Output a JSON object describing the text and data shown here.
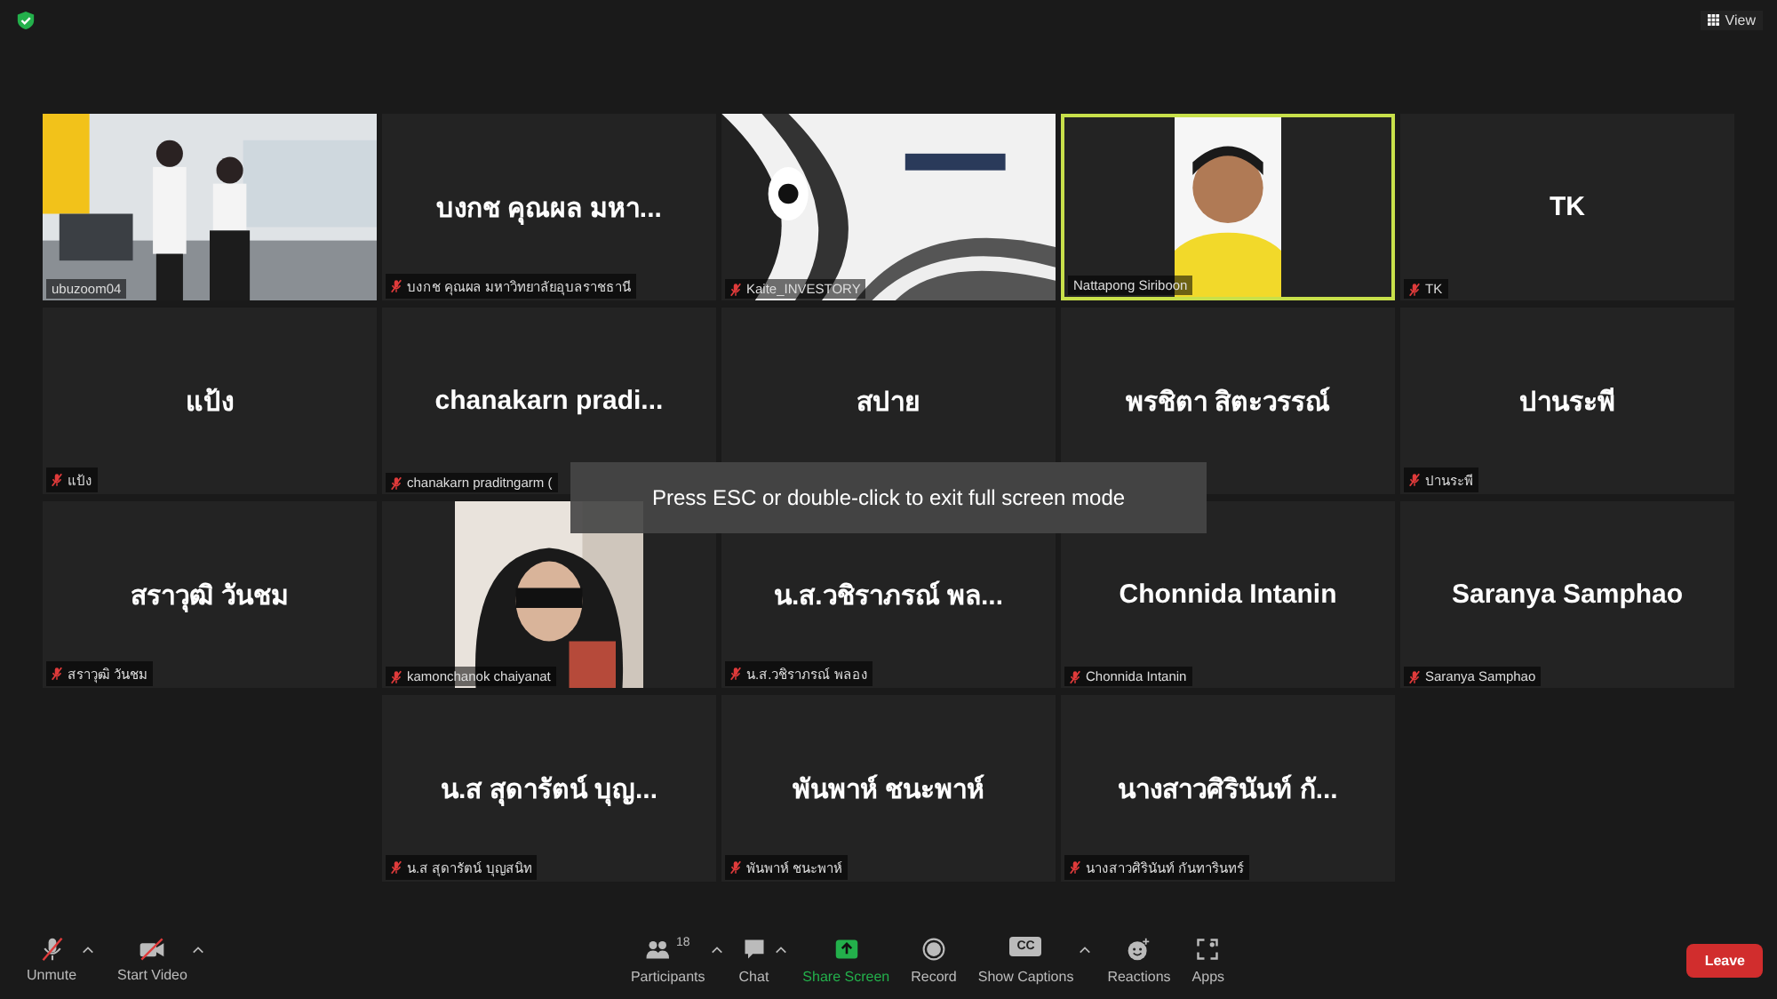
{
  "top_bar": {
    "view_button": "View"
  },
  "rows": [
    {
      "tiles": [
        {
          "kind": "video",
          "label": "ubuzoom04",
          "muted": false,
          "speaking": false,
          "portrait": false
        },
        {
          "kind": "name",
          "name": "บงกช คุณผล มหา...",
          "label": "บงกช คุณผล มหาวิทยาลัยอุบลราชธานี",
          "muted": true,
          "speaking": false
        },
        {
          "kind": "video",
          "label": "Kaite_INVESTORY",
          "muted": true,
          "speaking": false,
          "portrait": false
        },
        {
          "kind": "video",
          "label": "Nattapong Siriboon",
          "muted": false,
          "speaking": true,
          "portrait": true
        },
        {
          "kind": "name",
          "name": "TK",
          "label": "TK",
          "muted": true,
          "speaking": false
        }
      ]
    },
    {
      "tiles": [
        {
          "kind": "name",
          "name": "แป้ง",
          "label": "แป้ง",
          "muted": true,
          "speaking": false
        },
        {
          "kind": "name",
          "name": "chanakarn  pradi...",
          "label": "chanakarn praditngarm (",
          "muted": true,
          "speaking": false
        },
        {
          "kind": "name",
          "name": "สปาย",
          "speaking": false
        },
        {
          "kind": "name",
          "name": "พรชิตา สิตะวรรณ์",
          "speaking": false
        },
        {
          "kind": "name",
          "name": "ปานระพี",
          "label": "ปานระพี",
          "muted": true,
          "speaking": false
        }
      ]
    },
    {
      "tiles": [
        {
          "kind": "name",
          "name": "สราวุฒิ วันชม",
          "label": "สราวุฒิ วันชม",
          "muted": true,
          "speaking": false
        },
        {
          "kind": "video",
          "label": "kamonchanok chaiyanat",
          "muted": true,
          "speaking": false,
          "portrait": true
        },
        {
          "kind": "name",
          "name": "น.ส.วชิราภรณ์ พล...",
          "label": "น.ส.วชิราภรณ์ พลอง",
          "muted": true,
          "speaking": false
        },
        {
          "kind": "name",
          "name": "Chonnida Intanin",
          "label": "Chonnida Intanin",
          "muted": true,
          "speaking": false
        },
        {
          "kind": "name",
          "name": "Saranya Samphao",
          "label": "Saranya Samphao",
          "muted": true,
          "speaking": false
        }
      ]
    },
    {
      "tiles": [
        {
          "kind": "name",
          "name": "น.ส สุดารัตน์ บุญ...",
          "label": "น.ส สุดารัตน์ บุญสนิท",
          "muted": true,
          "speaking": false
        },
        {
          "kind": "name",
          "name": "พันพาห์ ชนะพาห์",
          "label": "พันพาห์ ชนะพาห์",
          "muted": true,
          "speaking": false
        },
        {
          "kind": "name",
          "name": "นางสาวศิรินันท์ กั...",
          "label": "นางสาวศิรินันท์ กันทารินทร์",
          "muted": true,
          "speaking": false
        }
      ]
    }
  ],
  "toast": "Press ESC or double-click to exit full screen mode",
  "toolbar": {
    "left": [
      {
        "kind": "mic",
        "label": "Unmute",
        "off": true
      },
      {
        "kind": "camera",
        "label": "Start Video",
        "off": true
      }
    ],
    "center": [
      {
        "kind": "participants",
        "label": "Participants",
        "count": "18",
        "caret": true
      },
      {
        "kind": "chat",
        "label": "Chat",
        "caret": true
      },
      {
        "kind": "share",
        "label": "Share Screen",
        "caret": false
      },
      {
        "kind": "record",
        "label": "Record",
        "caret": false
      },
      {
        "kind": "captions",
        "label": "Show Captions",
        "caret": true,
        "badge": "CC"
      },
      {
        "kind": "reactions",
        "label": "Reactions",
        "caret": false
      },
      {
        "kind": "apps",
        "label": "Apps",
        "caret": false
      }
    ],
    "leave": "Leave"
  }
}
